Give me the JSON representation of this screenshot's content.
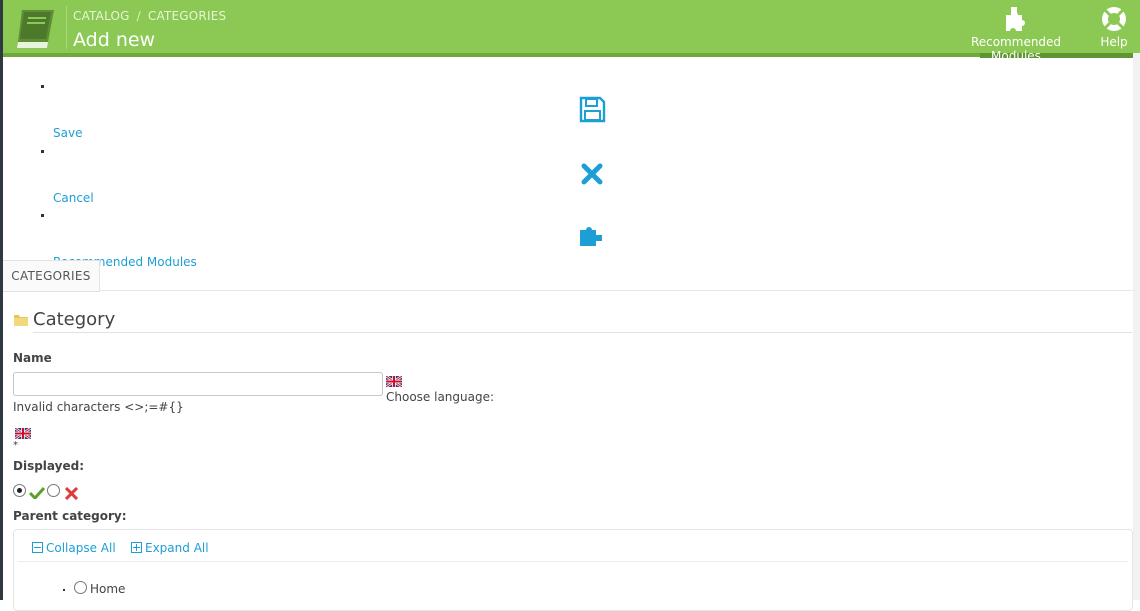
{
  "breadcrumb": {
    "item1": "CATALOG",
    "separator": "/",
    "item2": "CATEGORIES"
  },
  "page_title": "Add new",
  "header_buttons": {
    "recommended": "Recommended Modules",
    "help": "Help"
  },
  "toolbar": {
    "save_label": "Save",
    "cancel_label": "Cancel",
    "recommended_label": "Recommended Modules"
  },
  "tab": {
    "label": "CATEGORIES"
  },
  "section": {
    "title": "Category"
  },
  "form": {
    "name_label": "Name",
    "name_value": "",
    "invalid_chars": "Invalid characters <>;=#{}",
    "choose_language": "Choose language:",
    "required_mark": "*",
    "displayed_label": "Displayed:",
    "displayed_value": "yes",
    "parent_label": "Parent category:"
  },
  "tree": {
    "collapse_all": "Collapse All",
    "expand_all": "Expand All",
    "items": [
      {
        "label": "Home"
      }
    ]
  },
  "colors": {
    "header": "#8bc954",
    "link": "#1d9fd5",
    "yes": "#5aa02c",
    "no": "#e03b3b"
  },
  "icons": [
    "book-logo-icon",
    "puzzle-icon",
    "help-lifebuoy-icon",
    "save-icon",
    "close-icon",
    "folder-icon",
    "flag-uk-icon",
    "check-icon",
    "cross-icon",
    "collapse-icon",
    "expand-icon"
  ]
}
